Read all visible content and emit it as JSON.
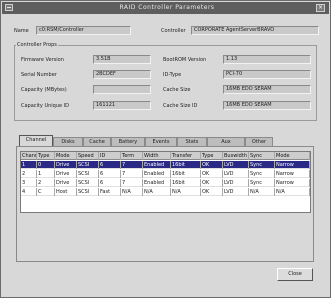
{
  "window": {
    "title": "RAID Controller Parameters"
  },
  "top": {
    "name_label": "Name",
    "name_value": "c0:RSM/Controller",
    "controller_label": "Controller",
    "controller_value": "CORPORATE AgentServerBRAVO"
  },
  "group": {
    "title": "Controller Props",
    "left": [
      {
        "label": "Firmware Version",
        "value": "3.51B"
      },
      {
        "label": "Serial Number",
        "value": "2BCDEF"
      },
      {
        "label": "Capacity (MBytes)",
        "value": ""
      },
      {
        "label": "Capacity Unique ID",
        "value": "161121"
      }
    ],
    "right": [
      {
        "label": "BootROM Version",
        "value": "1.13"
      },
      {
        "label": "ID-Type",
        "value": "PCI-70"
      },
      {
        "label": "Cache Size",
        "value": "16MB EDO SERAM"
      },
      {
        "label": "Cache Size ID",
        "value": "16MB EDO SERAM"
      }
    ]
  },
  "tabs": [
    "Channel",
    "Disks",
    "Cache",
    "Battery",
    "Events",
    "Stats",
    "Aux",
    "Other"
  ],
  "active_tab": "Channel",
  "table": {
    "columns": [
      "Channel",
      "Type",
      "Mode",
      "Speed",
      "ID",
      "Term",
      "Width",
      "Transfer",
      "Type",
      "Buswidth",
      "Sync",
      "Mode"
    ],
    "rows": [
      [
        "1",
        "0",
        "Drive",
        "SCSI",
        "6",
        "7",
        "Enabled",
        "16bit",
        "OK",
        "LVD",
        "Sync",
        "Narrow"
      ],
      [
        "2",
        "1",
        "Drive",
        "SCSI",
        "6",
        "7",
        "Enabled",
        "16bit",
        "OK",
        "LVD",
        "Sync",
        "Narrow"
      ],
      [
        "3",
        "2",
        "Drive",
        "SCSI",
        "6",
        "7",
        "Enabled",
        "16bit",
        "OK",
        "LVD",
        "Sync",
        "Narrow"
      ],
      [
        "4",
        "C",
        "Host",
        "SCSI",
        "Fast",
        "N/A",
        "N/A",
        "N/A",
        "OK",
        "LVD",
        "N/A",
        "N/A"
      ]
    ],
    "selected_row": 0
  },
  "buttons": {
    "close": "Close"
  },
  "colors": {
    "titlebar": "#5e5e5e",
    "selection": "#2a2a86",
    "panel": "#d8d8d8"
  }
}
